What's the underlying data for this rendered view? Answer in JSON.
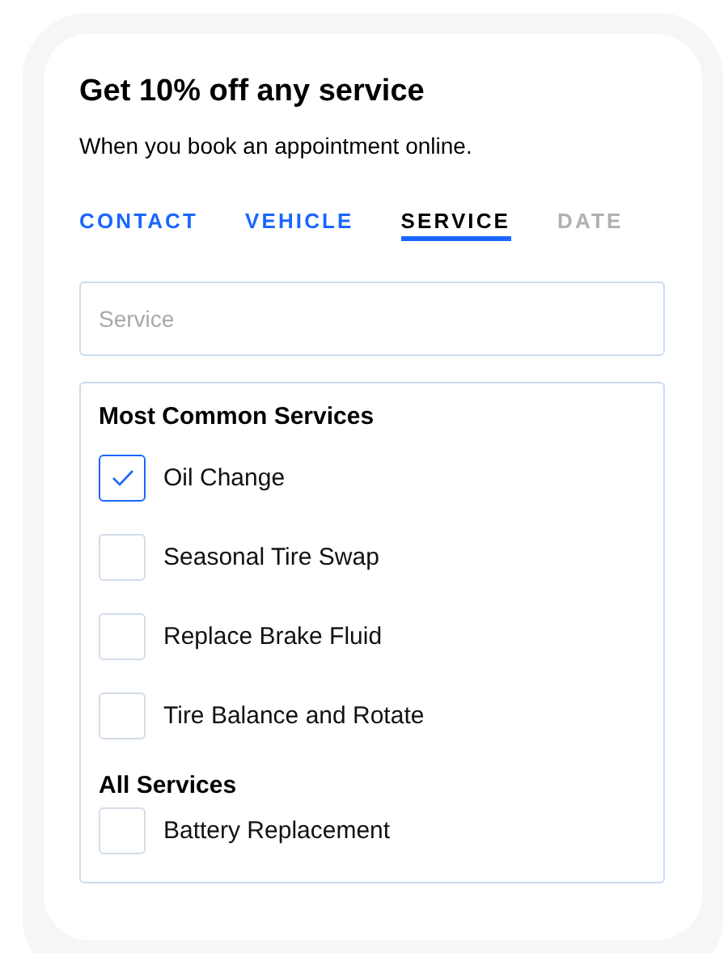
{
  "card": {
    "title": "Get 10% off any service",
    "subtitle": "When you book an appointment online."
  },
  "tabs": [
    {
      "label": "CONTACT",
      "selected": false,
      "disabled": false
    },
    {
      "label": "VEHICLE",
      "selected": false,
      "disabled": false
    },
    {
      "label": "SERVICE",
      "selected": true,
      "disabled": false
    },
    {
      "label": "DATE",
      "selected": false,
      "disabled": true
    }
  ],
  "search": {
    "placeholder": "Service"
  },
  "groups": [
    {
      "heading": "Most Common Services",
      "items": [
        {
          "label": "Oil Change",
          "checked": true
        },
        {
          "label": "Seasonal Tire Swap",
          "checked": false
        },
        {
          "label": "Replace Brake Fluid",
          "checked": false
        },
        {
          "label": "Tire Balance and Rotate",
          "checked": false
        }
      ]
    },
    {
      "heading": "All Services",
      "items": [
        {
          "label": "Battery Replacement",
          "checked": false
        }
      ]
    }
  ]
}
